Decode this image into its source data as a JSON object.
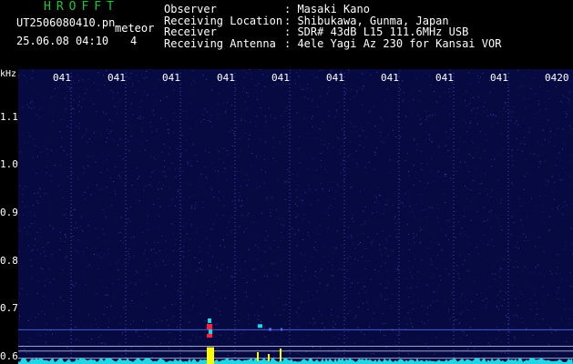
{
  "header": {
    "brand": "HROFFT",
    "filename": "UT2506080410.pn",
    "mode": "meteor",
    "datetime": "25.06.08 04:10",
    "count": "4"
  },
  "meta": [
    {
      "key": "Observer",
      "value": ": Masaki Kano"
    },
    {
      "key": "Receiving Location",
      "value": ": Shibukawa, Gunma, Japan"
    },
    {
      "key": "Receiver",
      "value": ": SDR# 43dB L15 111.6MHz USB"
    },
    {
      "key": "Receiving Antenna",
      "value": ": 4ele Yagi Az 230 for Kansai VOR"
    }
  ],
  "colors": {
    "background": "#000000",
    "plot_background": "#070a40",
    "brand": "#19c837",
    "text": "#ffffff",
    "cyan": "#1fd7e4",
    "yellow": "#ffff00",
    "red": "#ff2040"
  },
  "chart_data": {
    "type": "heatmap",
    "yunit": "kHz",
    "x_ticks": [
      "041",
      "041",
      "041",
      "041",
      "041",
      "041",
      "041",
      "041",
      "041",
      "0420"
    ],
    "y_ticks": [
      "1.1",
      "1.0",
      "0.9",
      "0.8",
      "0.7",
      "0.6"
    ],
    "ylim": [
      0.585,
      1.2
    ],
    "meteor_echo": {
      "minute_fraction": 0.34,
      "freq_low": 0.585,
      "freq_high": 0.68
    }
  }
}
